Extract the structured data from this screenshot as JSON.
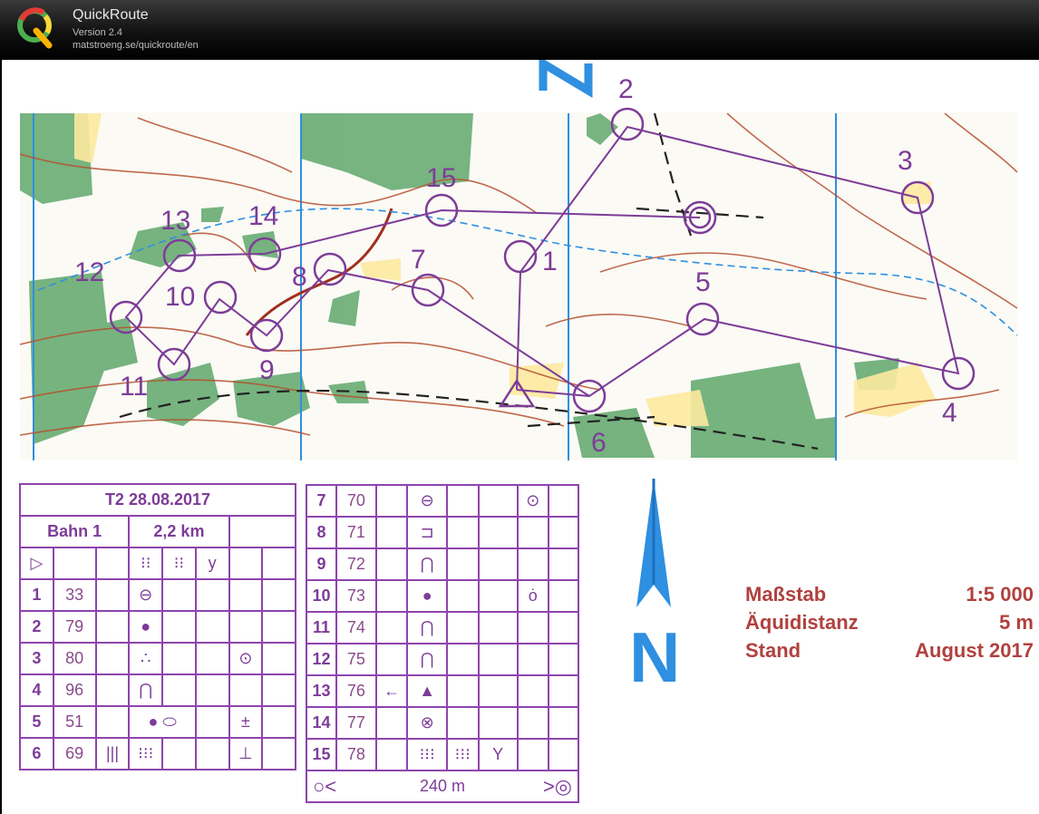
{
  "app": {
    "title": "QuickRoute",
    "version": "Version 2.4",
    "url": "matstroeng.se/quickroute/en"
  },
  "map": {
    "controls": [
      "1",
      "2",
      "3",
      "4",
      "5",
      "6",
      "7",
      "8",
      "9",
      "10",
      "11",
      "12",
      "13",
      "14",
      "15"
    ],
    "north_label": "N",
    "colors": {
      "purple": "#7d3c98",
      "brown": "#b5502f",
      "green": "#4a9c5d",
      "blue": "#2f8fe0",
      "scale_text": "#b0413e"
    }
  },
  "descriptions": {
    "left": {
      "header": "T2 28.08.2017",
      "course": "Bahn 1",
      "length": "2,2 km",
      "rows": [
        {
          "no": "1",
          "code": "33",
          "sym": "⊖",
          "extra": ""
        },
        {
          "no": "2",
          "code": "79",
          "sym": "●",
          "extra": ""
        },
        {
          "no": "3",
          "code": "80",
          "sym": "∴",
          "extra": "⊙"
        },
        {
          "no": "4",
          "code": "96",
          "sym": "⋂",
          "extra": ""
        },
        {
          "no": "5",
          "code": "51",
          "sym": "● ⬭",
          "extra": "±"
        },
        {
          "no": "6",
          "code": "69",
          "sym": "⁝⁝⁝",
          "extra": "⊥"
        }
      ]
    },
    "right": {
      "rows": [
        {
          "no": "7",
          "code": "70",
          "sym": "⊖",
          "extra": "⊙"
        },
        {
          "no": "8",
          "code": "71",
          "sym": "⊐",
          "extra": ""
        },
        {
          "no": "9",
          "code": "72",
          "sym": "⋂",
          "extra": ""
        },
        {
          "no": "10",
          "code": "73",
          "sym": "●",
          "extra": "ȯ"
        },
        {
          "no": "11",
          "code": "74",
          "sym": "⋂",
          "extra": ""
        },
        {
          "no": "12",
          "code": "75",
          "sym": "⋂",
          "extra": ""
        },
        {
          "no": "13",
          "code": "76",
          "sym": "▲",
          "extra": ""
        },
        {
          "no": "14",
          "code": "77",
          "sym": "⊗",
          "extra": ""
        },
        {
          "no": "15",
          "code": "78",
          "sym": "⁝⁝⁝",
          "extra": "Y"
        }
      ],
      "finish": "240 m"
    }
  },
  "scale": {
    "rows": [
      {
        "label": "Maßstab",
        "value": "1:5 000"
      },
      {
        "label": "Äquidistanz",
        "value": "5 m"
      },
      {
        "label": "Stand",
        "value": "August 2017"
      }
    ]
  }
}
